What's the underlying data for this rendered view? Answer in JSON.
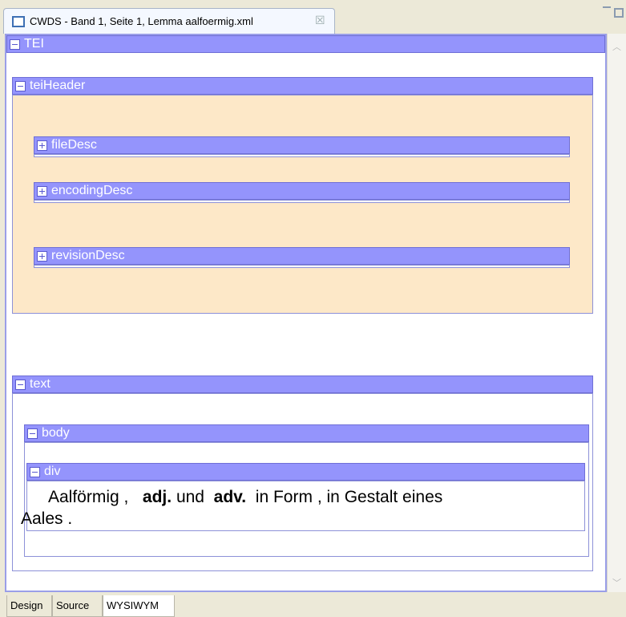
{
  "tab": {
    "title": "CWDS - Band 1, Seite 1, Lemma aalfoermig.xml",
    "close_glyph": "☒",
    "icon": "document-icon"
  },
  "tree": {
    "tei": "TEI",
    "teiHeader": "teiHeader",
    "fileDesc": "fileDesc",
    "encodingDesc": "encodingDesc",
    "revisionDesc": "revisionDesc",
    "text": "text",
    "body": "body",
    "div": "div"
  },
  "content": {
    "word": "Aalförmig",
    "punct1": ",",
    "pos1": "adj.",
    "und": "und",
    "pos2": "adv.",
    "def1": "in Form",
    "punct2": ",",
    "def2": "in Gestalt eines",
    "def3": "Aales",
    "punct3": "."
  },
  "bottom_tabs": [
    "Design",
    "Source",
    "WYSIWYM"
  ],
  "colors": {
    "element_bar": "#9494fc",
    "header_background": "#fde8c8",
    "editor_background": "#ffffff"
  }
}
